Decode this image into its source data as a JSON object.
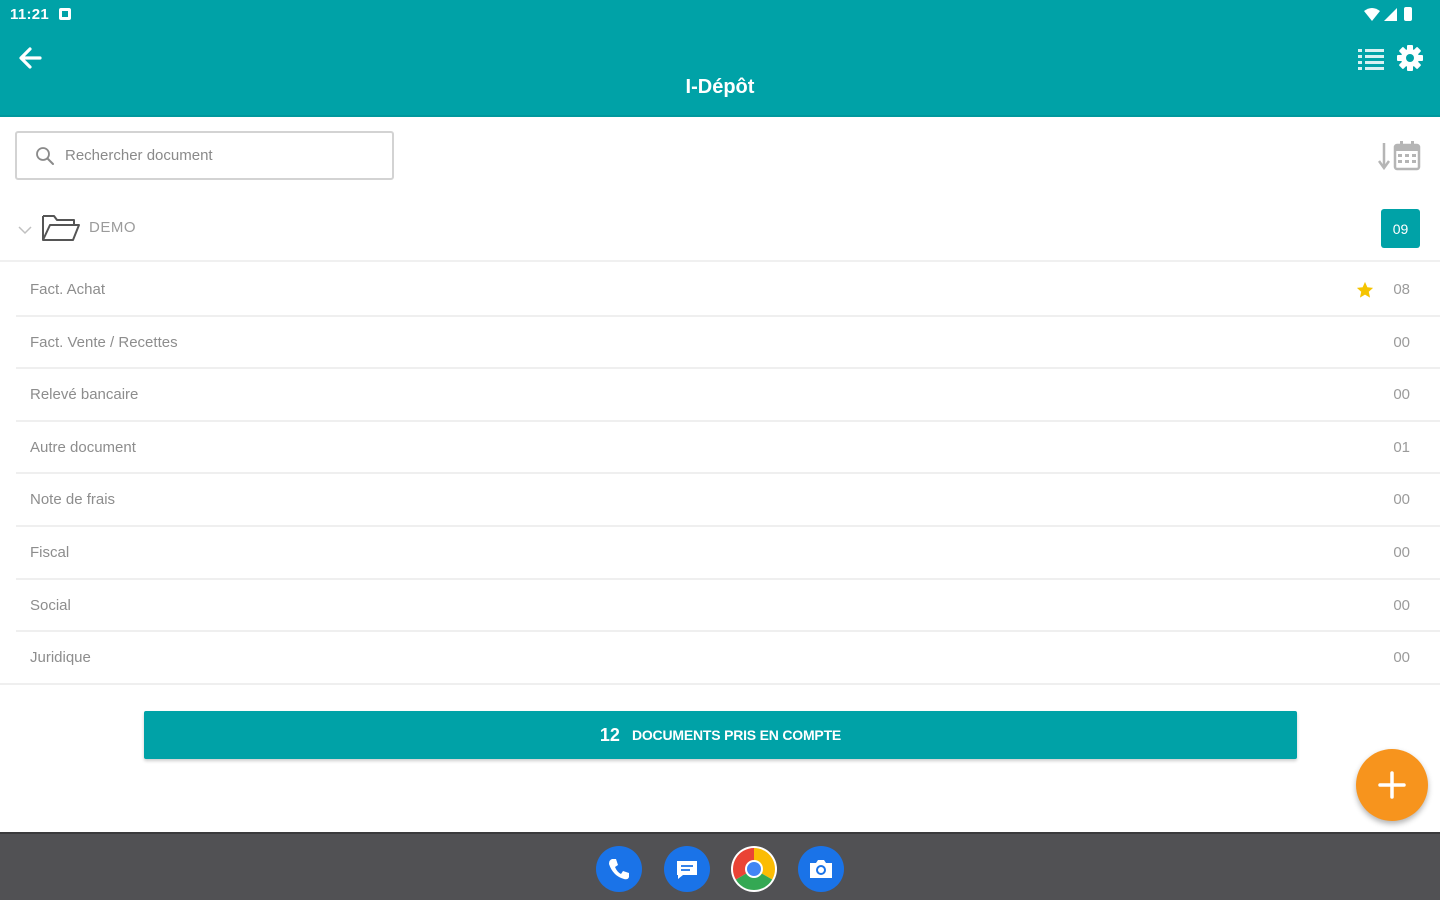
{
  "status_bar": {
    "time": "11:21"
  },
  "app_bar": {
    "title": "I-Dépôt",
    "color": "#00a2a7",
    "icons": [
      "back-arrow-icon",
      "list-view-icon",
      "gear-icon"
    ]
  },
  "search": {
    "placeholder": "Rechercher document",
    "value": ""
  },
  "folder": {
    "name": "DEMO",
    "badge": "09",
    "expanded": true
  },
  "documents": [
    {
      "label": "Fact. Achat",
      "count": "08",
      "starred": true
    },
    {
      "label": "Fact. Vente / Recettes",
      "count": "00",
      "starred": false
    },
    {
      "label": "Relevé bancaire",
      "count": "00",
      "starred": false
    },
    {
      "label": "Autre document",
      "count": "01",
      "starred": false
    },
    {
      "label": "Note de frais",
      "count": "00",
      "starred": false
    },
    {
      "label": "Fiscal",
      "count": "00",
      "starred": false
    },
    {
      "label": "Social",
      "count": "00",
      "starred": false
    },
    {
      "label": "Juridique",
      "count": "00",
      "starred": false
    }
  ],
  "summary": {
    "count": "12",
    "label": "DOCUMENTS PRIS EN COMPTE"
  },
  "fab": {
    "icon": "plus-icon",
    "color": "#f7941d"
  },
  "dock": [
    "phone-app-icon",
    "messages-app-icon",
    "chrome-app-icon",
    "camera-app-icon"
  ]
}
